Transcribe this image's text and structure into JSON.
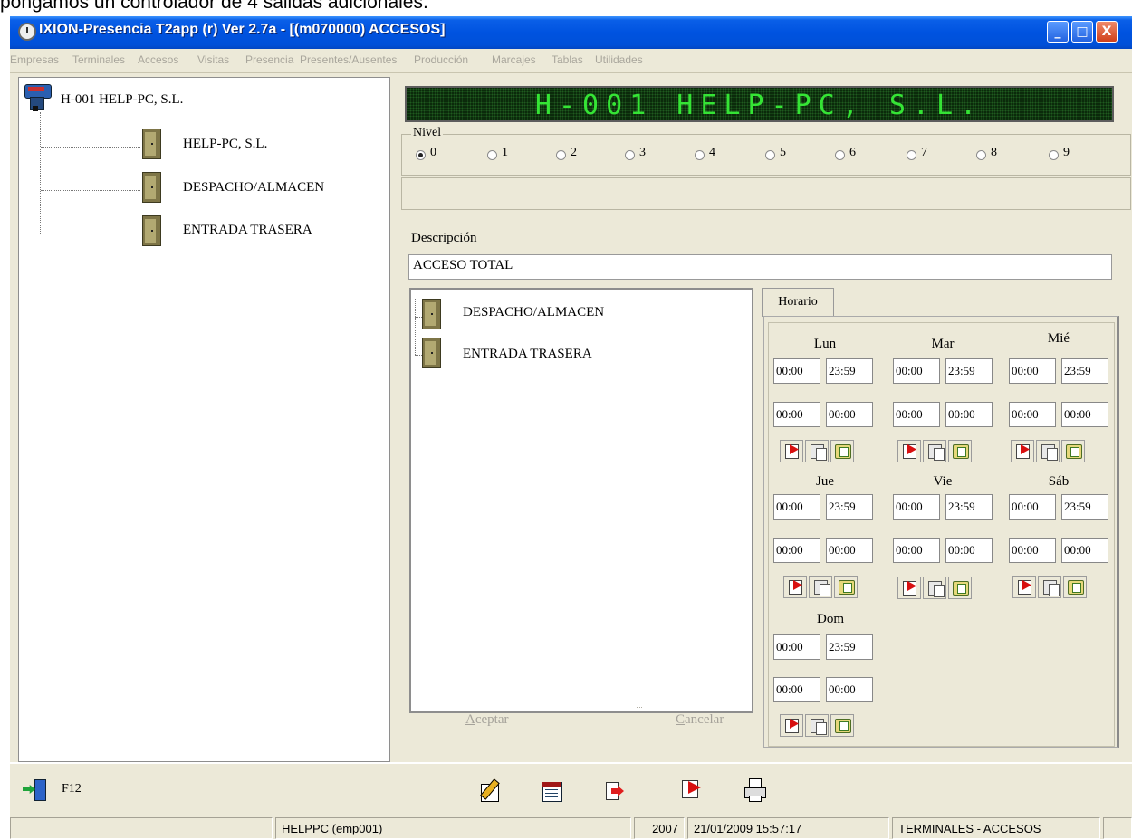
{
  "top_caption": "pongamos un controlador de 4 salidas adicionales.",
  "window": {
    "title": "IXION-Presencia T2app (r) Ver 2.7a - [(m070000)  ACCESOS]",
    "buttons": {
      "minimize": "_",
      "maximize": "□",
      "close": "X"
    }
  },
  "menu": [
    "Empresas",
    "Terminales",
    "Accesos",
    "Visitas",
    "Presencia",
    "Presentes/Ausentes",
    "Producción",
    "Marcajes",
    "Tablas",
    "Utilidades"
  ],
  "tree": {
    "root": "H-001 HELP-PC, S.L.",
    "children": [
      "HELP-PC, S.L.",
      "DESPACHO/ALMACEN",
      "ENTRADA TRASERA"
    ]
  },
  "led_display": "H-001 HELP-PC, S.L.",
  "nivel": {
    "label": "Nivel",
    "options": [
      "0",
      "1",
      "2",
      "3",
      "4",
      "5",
      "6",
      "7",
      "8",
      "9"
    ],
    "selected": "0"
  },
  "descripcion": {
    "label": "Descripción",
    "value": "ACCESO TOTAL"
  },
  "doors": [
    "DESPACHO/ALMACEN",
    "ENTRADA TRASERA"
  ],
  "buttons": {
    "accept": "Aceptar",
    "cancel": "Cancelar"
  },
  "horario": {
    "tab": "Horario",
    "days": [
      {
        "name": "Lun",
        "t1": "00:00",
        "t2": "23:59",
        "t3": "00:00",
        "t4": "00:00"
      },
      {
        "name": "Mar",
        "t1": "00:00",
        "t2": "23:59",
        "t3": "00:00",
        "t4": "00:00"
      },
      {
        "name": "Mié",
        "t1": "00:00",
        "t2": "23:59",
        "t3": "00:00",
        "t4": "00:00"
      },
      {
        "name": "Jue",
        "t1": "00:00",
        "t2": "23:59",
        "t3": "00:00",
        "t4": "00:00"
      },
      {
        "name": "Vie",
        "t1": "00:00",
        "t2": "23:59",
        "t3": "00:00",
        "t4": "00:00"
      },
      {
        "name": "Sáb",
        "t1": "00:00",
        "t2": "23:59",
        "t3": "00:00",
        "t4": "00:00"
      },
      {
        "name": "Dom",
        "t1": "00:00",
        "t2": "23:59",
        "t3": "00:00",
        "t4": "00:00"
      }
    ]
  },
  "toolbar": {
    "exit_key": "F12",
    "icons": [
      "edit-icon",
      "list-icon",
      "next-icon",
      "cut-icon",
      "print-icon"
    ]
  },
  "status": {
    "user": "HELPPC  (emp001)",
    "year": "2007",
    "datetime": "21/01/2009  15:57:17",
    "module": "TERMINALES - ACCESOS"
  }
}
